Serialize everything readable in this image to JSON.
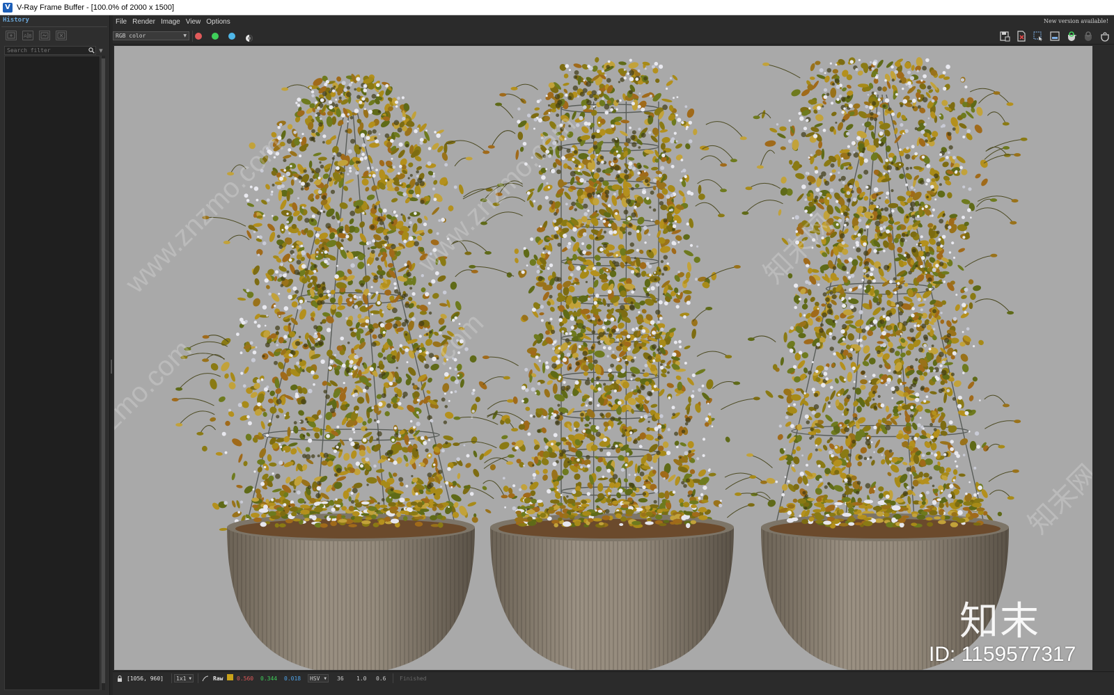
{
  "window": {
    "title": "V-Ray Frame Buffer - [100.0% of 2000 x 1500]"
  },
  "history": {
    "tab_label": "History",
    "search_placeholder": "Search filter"
  },
  "menu": {
    "items": [
      "File",
      "Render",
      "Image",
      "View",
      "Options"
    ],
    "update_notice": "New version available!"
  },
  "toolbar": {
    "channel": "RGB color",
    "channel_dots": [
      {
        "name": "red-channel",
        "color": "#e05a5a"
      },
      {
        "name": "green-channel",
        "color": "#3fcf5a"
      },
      {
        "name": "blue-channel",
        "color": "#4fb7e8"
      }
    ],
    "right_icons": [
      "save-image-icon",
      "clear-image-icon",
      "region-render-icon",
      "track-mouse-icon",
      "render-icon",
      "interactive-render-icon",
      "stop-render-icon"
    ]
  },
  "render": {
    "background_color": "#a9a9a9",
    "watermarks": [
      "www.znzmo.com",
      "www.znzmo.com",
      "知末网",
      "知末网",
      "znzmo.com",
      ".com"
    ],
    "brand_mark": "知末",
    "brand_id": "ID: 1159577317"
  },
  "status": {
    "coords": "[1056, 960]",
    "zoom": "1x1",
    "mode": "Raw",
    "r": "0.560",
    "g": "0.344",
    "b": "0.018",
    "color_space": "HSV",
    "h": "36",
    "s": "1.0",
    "v": "0.6",
    "state": "Finished",
    "colors": {
      "r": "#e05a5a",
      "g": "#3fcf5a",
      "b": "#4fa3e8",
      "swatch": "#c9a21a"
    }
  }
}
